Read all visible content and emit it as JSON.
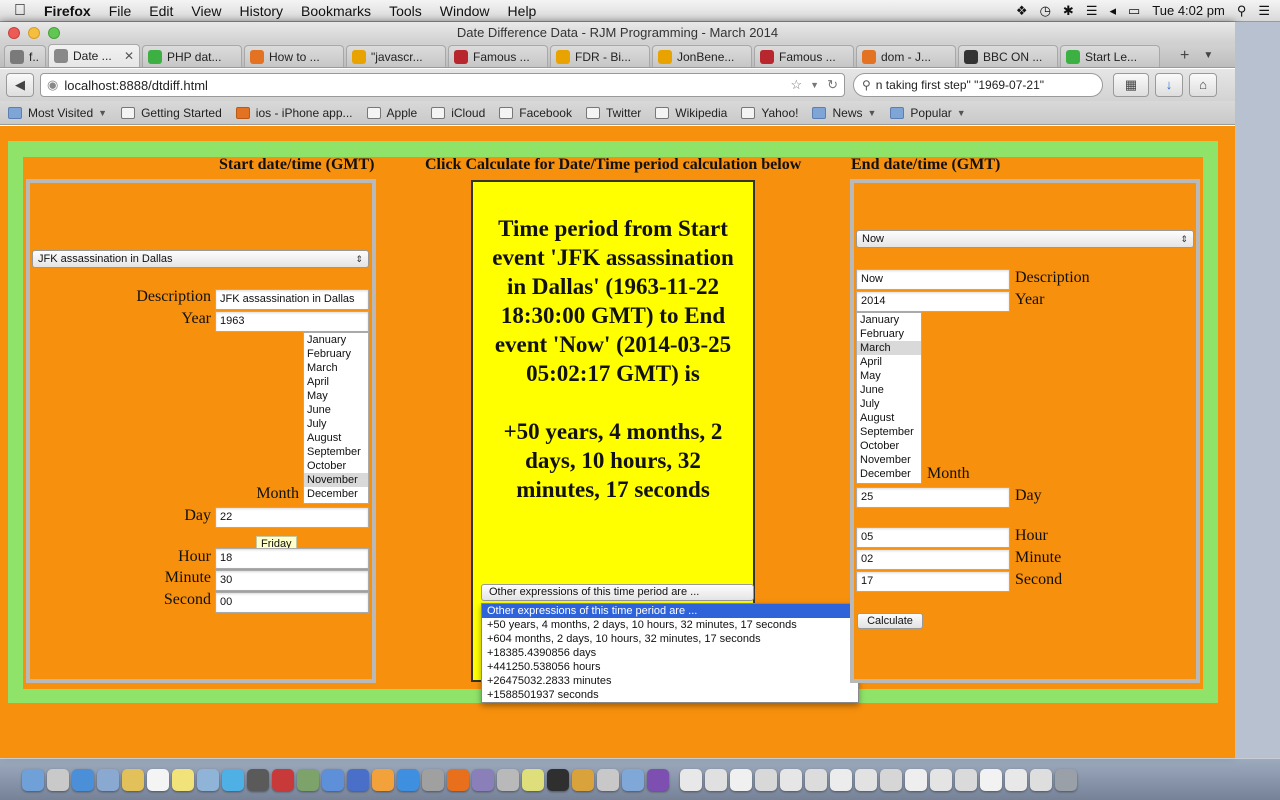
{
  "menubar": {
    "app": "Firefox",
    "menus": [
      "File",
      "Edit",
      "View",
      "History",
      "Bookmarks",
      "Tools",
      "Window",
      "Help"
    ],
    "clock": "Tue 4:02 pm"
  },
  "window": {
    "title": "Date Difference Data - RJM Programming - March 2014"
  },
  "tabs": [
    {
      "label": "f...",
      "color": "#7a7a7a"
    },
    {
      "label": "Date ...",
      "color": "#888888",
      "active": true
    },
    {
      "label": "PHP dat...",
      "color": "#3cb043"
    },
    {
      "label": "How to ...",
      "color": "#e37222"
    },
    {
      "label": "\"javascr...",
      "color": "#e8a300"
    },
    {
      "label": "Famous ...",
      "color": "#b8262e"
    },
    {
      "label": "FDR - Bi...",
      "color": "#e8a300"
    },
    {
      "label": "JonBene...",
      "color": "#e8a300"
    },
    {
      "label": "Famous ...",
      "color": "#b8262e"
    },
    {
      "label": "dom - J...",
      "color": "#e37222"
    },
    {
      "label": "BBC ON ...",
      "color": "#333333"
    },
    {
      "label": "Start Le...",
      "color": "#3cb043"
    }
  ],
  "nav": {
    "url": "localhost:8888/dtdiff.html",
    "search": "n taking first step\" \"1969-07-21\""
  },
  "bookmarks": [
    {
      "label": "Most Visited",
      "caret": true
    },
    {
      "label": "Getting Started"
    },
    {
      "label": "ios - iPhone app..."
    },
    {
      "label": "Apple"
    },
    {
      "label": "iCloud"
    },
    {
      "label": "Facebook"
    },
    {
      "label": "Twitter"
    },
    {
      "label": "Wikipedia"
    },
    {
      "label": "Yahoo!"
    },
    {
      "label": "News",
      "folder": true,
      "caret": true
    },
    {
      "label": "Popular",
      "folder": true,
      "caret": true
    }
  ],
  "page": {
    "start_heading": "Start date/time (GMT)",
    "center_heading": "Click Calculate for Date/Time period calculation below",
    "end_heading": "End date/time (GMT)",
    "start": {
      "event_select": "JFK assassination in Dallas",
      "description_label": "Description",
      "description": "JFK assassination in Dallas",
      "year_label": "Year",
      "year": "1963",
      "month_label": "Month",
      "months": [
        "January",
        "February",
        "March",
        "April",
        "May",
        "June",
        "July",
        "August",
        "September",
        "October",
        "November",
        "December"
      ],
      "selected_month": "November",
      "day_label": "Day",
      "day": "22",
      "day_tooltip": "Friday",
      "hour_label": "Hour",
      "hour": "18",
      "minute_label": "Minute",
      "minute": "30",
      "second_label": "Second",
      "second": "00"
    },
    "end": {
      "event_select": "Now",
      "description_label": "Description",
      "description": "Now",
      "year_label": "Year",
      "year": "2014",
      "month_label": "Month",
      "months": [
        "January",
        "February",
        "March",
        "April",
        "May",
        "June",
        "July",
        "August",
        "September",
        "October",
        "November",
        "December"
      ],
      "selected_month": "March",
      "day_label": "Day",
      "day": "25",
      "hour_label": "Hour",
      "hour": "05",
      "minute_label": "Minute",
      "minute": "02",
      "second_label": "Second",
      "second": "17",
      "calculate": "Calculate"
    },
    "result": "Time period from Start event 'JFK assassination in Dallas' (1963-11-22 18:30:00 GMT) to End event 'Now' (2014-03-25 05:02:17 GMT) is\n\n+50 years, 4 months, 2 days, 10 hours, 32 minutes, 17 seconds",
    "expressions": {
      "selected": "Other expressions of this time period are ...",
      "options": [
        "Other expressions of this time period are ...",
        "+50 years, 4 months, 2 days, 10 hours, 32 minutes, 17 seconds",
        "+604 months, 2 days, 10 hours, 32 minutes, 17 seconds",
        "+18385.4390856 days",
        "+441250.538056 hours",
        "+26475032.2833 minutes",
        "+1588501937 seconds"
      ]
    }
  },
  "dock": {
    "icons": [
      "finder-icon",
      "launchpad-icon",
      "safari-icon",
      "mail-icon",
      "notes-icon",
      "calendar-icon",
      "stickies-icon",
      "preview-icon",
      "messages-icon",
      "facetime-icon",
      "photobooth-icon",
      "grapher-icon",
      "itunes-icon",
      "music-icon",
      "ibooks-icon",
      "appstore-icon",
      "sysprefs-icon",
      "firefox-icon",
      "app1-icon",
      "app2-icon",
      "app3-icon",
      "terminal-icon",
      "app4-icon",
      "app5-icon",
      "app6-icon",
      "app7-icon",
      "doc1-icon",
      "doc2-icon",
      "doc3-icon",
      "doc4-icon",
      "doc5-icon",
      "doc6-icon",
      "doc7-icon",
      "doc8-icon",
      "doc9-icon",
      "doc10-icon",
      "doc11-icon",
      "doc12-icon",
      "doc13-icon",
      "doc14-icon",
      "doc15-icon",
      "trash-icon"
    ],
    "colors": [
      "#6fa0d8",
      "#c9c9c9",
      "#4c8fd9",
      "#8aa9d1",
      "#e2c15a",
      "#f4f4f4",
      "#f2e27a",
      "#8fb4d8",
      "#4fb0e6",
      "#5a5a5a",
      "#c83a3a",
      "#7ea36a",
      "#5e8fd9",
      "#4a6fc9",
      "#f3a13b",
      "#3f8fe0",
      "#a0a0a0",
      "#e8701d",
      "#8a7fb8",
      "#b9b9b9",
      "#dede7a",
      "#2f2f2f",
      "#d9a23a",
      "#c8c8c8",
      "#7fa7d8",
      "#7d4fb0",
      "#e8e8e8",
      "#e0e0e0",
      "#f0f0f0",
      "#d8d8d8",
      "#e6e6e6",
      "#dcdcdc",
      "#ececec",
      "#e2e2e2",
      "#d6d6d6",
      "#eeeeee",
      "#e4e4e4",
      "#dadada",
      "#f2f2f2",
      "#e8e8e8",
      "#dedede",
      "#9aa0a8"
    ]
  }
}
